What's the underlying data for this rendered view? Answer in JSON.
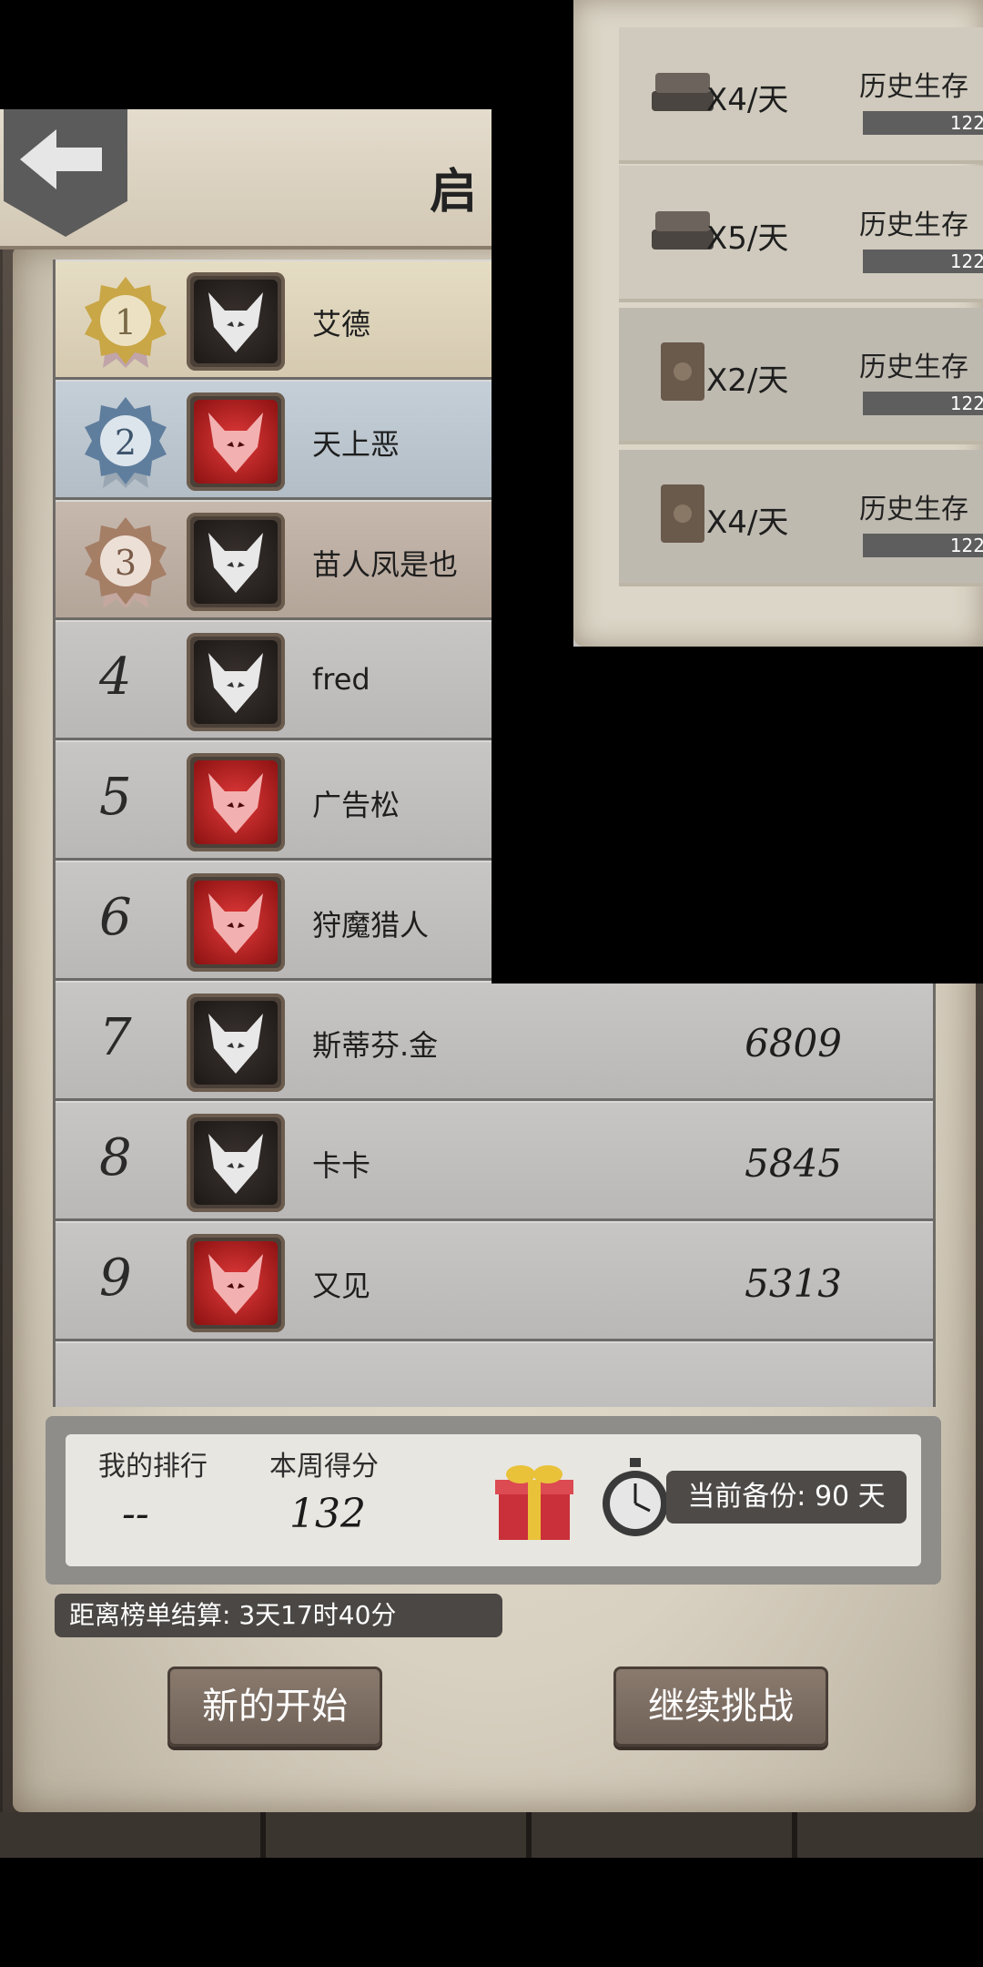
{
  "header": {
    "title": "启"
  },
  "leaderboard": {
    "rows": [
      {
        "rank": "1",
        "name": "艾德",
        "score": "",
        "avatar": "dark"
      },
      {
        "rank": "2",
        "name": "天上恶",
        "score": "",
        "avatar": "red"
      },
      {
        "rank": "3",
        "name": "苗人凤是也",
        "score": "",
        "avatar": "dark"
      },
      {
        "rank": "4",
        "name": "fred",
        "score": "",
        "avatar": "dark"
      },
      {
        "rank": "5",
        "name": "广告松",
        "score": "",
        "avatar": "red"
      },
      {
        "rank": "6",
        "name": "狩魔猎人",
        "score": "",
        "avatar": "red"
      },
      {
        "rank": "7",
        "name": "斯蒂芬.金",
        "score": "6809",
        "avatar": "dark"
      },
      {
        "rank": "8",
        "name": "卡卡",
        "score": "5845",
        "avatar": "dark"
      },
      {
        "rank": "9",
        "name": "又见",
        "score": "5313",
        "avatar": "red"
      }
    ]
  },
  "info": {
    "my_rank_label": "我的排行",
    "my_rank_value": "--",
    "week_score_label": "本周得分",
    "week_score_value": "132",
    "backup_text": "当前备份: 90 天"
  },
  "countdown": "距离榜单结算: 3天17时40分",
  "buttons": {
    "new_start": "新的开始",
    "continue": "继续挑战"
  },
  "popup": {
    "items": [
      {
        "mult": "X4/天",
        "label": "历史生存",
        "bar": "122"
      },
      {
        "mult": "X5/天",
        "label": "历史生存",
        "bar": "122"
      },
      {
        "mult": "X2/天",
        "label": "历史生存",
        "bar": "122"
      },
      {
        "mult": "X4/天",
        "label": "历史生存",
        "bar": "122"
      }
    ]
  },
  "colors": {
    "medal_gold": "#c9a646",
    "medal_silver": "#7d9ab8",
    "medal_bronze": "#a57e66",
    "red_avatar": "#c52424"
  }
}
